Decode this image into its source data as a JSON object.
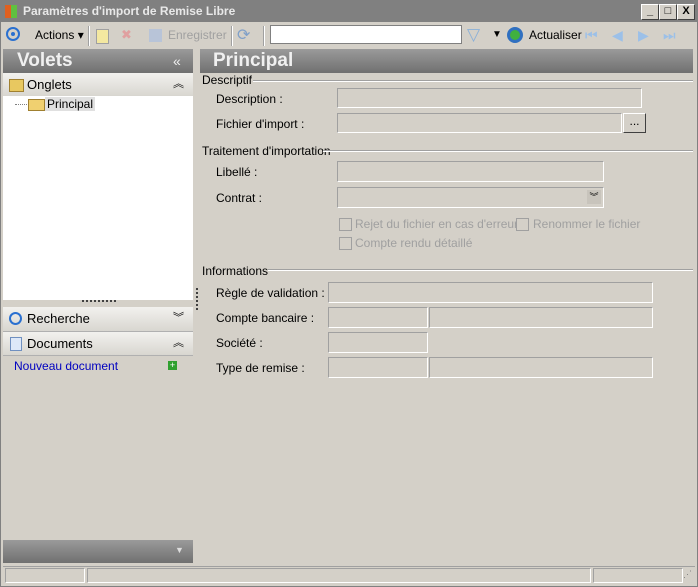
{
  "window": {
    "title": "Paramètres d'import de Remise Libre",
    "minimize": "_",
    "maximize": "□",
    "close": "X"
  },
  "toolbar": {
    "actions": "Actions",
    "save": "Enregistrer",
    "search_value": "",
    "refresh": "Actualiser"
  },
  "left": {
    "header": "Volets",
    "collapse": "«",
    "onglets": "Onglets",
    "tree_item": "Principal",
    "recherche": "Recherche",
    "documents": "Documents",
    "new_document": "Nouveau document"
  },
  "main": {
    "header": "Principal",
    "descriptif": {
      "title": "Descriptif",
      "description_label": "Description :",
      "description_value": "",
      "file_label": "Fichier d'import :",
      "file_value": "",
      "browse": "..."
    },
    "traitement": {
      "title": "Traitement d'importation",
      "libelle_label": "Libellé :",
      "libelle_value": "",
      "contrat_label": "Contrat  :",
      "contrat_value": "",
      "reject": "Rejet du fichier en cas d'erreur",
      "rename": "Renommer le fichier",
      "report": "Compte rendu détaillé"
    },
    "informations": {
      "title": "Informations",
      "rule_label": "Règle de validation :",
      "bank_label": "Compte bancaire :",
      "company_label": "Société :",
      "type_label": "Type de remise :"
    }
  }
}
